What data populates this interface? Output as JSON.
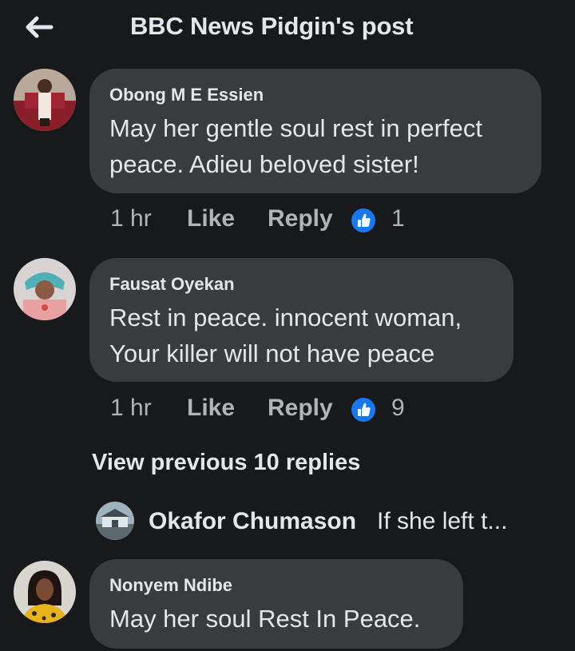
{
  "header": {
    "title": "BBC News Pidgin's post",
    "back_icon": "arrow-left-icon"
  },
  "comments": [
    {
      "author": "Obong M E Essien",
      "lines": [
        "May her gentle soul rest in perfect",
        "peace. Adieu beloved sister!"
      ],
      "time": "1 hr",
      "like_label": "Like",
      "reply_label": "Reply",
      "reaction_icon": "thumbs-up-icon",
      "reaction_count": "1"
    },
    {
      "author": "Fausat Oyekan",
      "lines": [
        "Rest in peace. innocent woman,",
        "Your killer will not have peace"
      ],
      "time": "1 hr",
      "like_label": "Like",
      "reply_label": "Reply",
      "reaction_icon": "thumbs-up-icon",
      "reaction_count": "9"
    },
    {
      "author": "Nonyem Ndibe",
      "lines": [
        "May her soul Rest In Peace."
      ]
    }
  ],
  "view_previous": "View previous 10 replies",
  "reply_preview": {
    "author": "Okafor Chumason",
    "text": "If she left t..."
  },
  "colors": {
    "background": "#18191a",
    "bubble": "#3a3b3c",
    "primary_text": "#e4e6eb",
    "secondary_text": "#b0b3b8",
    "like_blue": "#1877f2"
  }
}
